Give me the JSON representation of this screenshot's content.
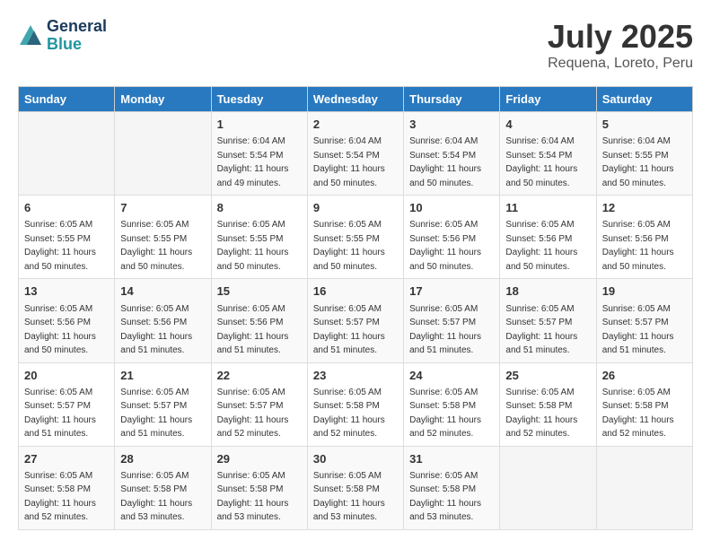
{
  "header": {
    "logo_line1": "General",
    "logo_line2": "Blue",
    "month_title": "July 2025",
    "location": "Requena, Loreto, Peru"
  },
  "days_of_week": [
    "Sunday",
    "Monday",
    "Tuesday",
    "Wednesday",
    "Thursday",
    "Friday",
    "Saturday"
  ],
  "weeks": [
    [
      {
        "day": "",
        "info": ""
      },
      {
        "day": "",
        "info": ""
      },
      {
        "day": "1",
        "info": "Sunrise: 6:04 AM\nSunset: 5:54 PM\nDaylight: 11 hours and 49 minutes."
      },
      {
        "day": "2",
        "info": "Sunrise: 6:04 AM\nSunset: 5:54 PM\nDaylight: 11 hours and 50 minutes."
      },
      {
        "day": "3",
        "info": "Sunrise: 6:04 AM\nSunset: 5:54 PM\nDaylight: 11 hours and 50 minutes."
      },
      {
        "day": "4",
        "info": "Sunrise: 6:04 AM\nSunset: 5:54 PM\nDaylight: 11 hours and 50 minutes."
      },
      {
        "day": "5",
        "info": "Sunrise: 6:04 AM\nSunset: 5:55 PM\nDaylight: 11 hours and 50 minutes."
      }
    ],
    [
      {
        "day": "6",
        "info": "Sunrise: 6:05 AM\nSunset: 5:55 PM\nDaylight: 11 hours and 50 minutes."
      },
      {
        "day": "7",
        "info": "Sunrise: 6:05 AM\nSunset: 5:55 PM\nDaylight: 11 hours and 50 minutes."
      },
      {
        "day": "8",
        "info": "Sunrise: 6:05 AM\nSunset: 5:55 PM\nDaylight: 11 hours and 50 minutes."
      },
      {
        "day": "9",
        "info": "Sunrise: 6:05 AM\nSunset: 5:55 PM\nDaylight: 11 hours and 50 minutes."
      },
      {
        "day": "10",
        "info": "Sunrise: 6:05 AM\nSunset: 5:56 PM\nDaylight: 11 hours and 50 minutes."
      },
      {
        "day": "11",
        "info": "Sunrise: 6:05 AM\nSunset: 5:56 PM\nDaylight: 11 hours and 50 minutes."
      },
      {
        "day": "12",
        "info": "Sunrise: 6:05 AM\nSunset: 5:56 PM\nDaylight: 11 hours and 50 minutes."
      }
    ],
    [
      {
        "day": "13",
        "info": "Sunrise: 6:05 AM\nSunset: 5:56 PM\nDaylight: 11 hours and 50 minutes."
      },
      {
        "day": "14",
        "info": "Sunrise: 6:05 AM\nSunset: 5:56 PM\nDaylight: 11 hours and 51 minutes."
      },
      {
        "day": "15",
        "info": "Sunrise: 6:05 AM\nSunset: 5:56 PM\nDaylight: 11 hours and 51 minutes."
      },
      {
        "day": "16",
        "info": "Sunrise: 6:05 AM\nSunset: 5:57 PM\nDaylight: 11 hours and 51 minutes."
      },
      {
        "day": "17",
        "info": "Sunrise: 6:05 AM\nSunset: 5:57 PM\nDaylight: 11 hours and 51 minutes."
      },
      {
        "day": "18",
        "info": "Sunrise: 6:05 AM\nSunset: 5:57 PM\nDaylight: 11 hours and 51 minutes."
      },
      {
        "day": "19",
        "info": "Sunrise: 6:05 AM\nSunset: 5:57 PM\nDaylight: 11 hours and 51 minutes."
      }
    ],
    [
      {
        "day": "20",
        "info": "Sunrise: 6:05 AM\nSunset: 5:57 PM\nDaylight: 11 hours and 51 minutes."
      },
      {
        "day": "21",
        "info": "Sunrise: 6:05 AM\nSunset: 5:57 PM\nDaylight: 11 hours and 51 minutes."
      },
      {
        "day": "22",
        "info": "Sunrise: 6:05 AM\nSunset: 5:57 PM\nDaylight: 11 hours and 52 minutes."
      },
      {
        "day": "23",
        "info": "Sunrise: 6:05 AM\nSunset: 5:58 PM\nDaylight: 11 hours and 52 minutes."
      },
      {
        "day": "24",
        "info": "Sunrise: 6:05 AM\nSunset: 5:58 PM\nDaylight: 11 hours and 52 minutes."
      },
      {
        "day": "25",
        "info": "Sunrise: 6:05 AM\nSunset: 5:58 PM\nDaylight: 11 hours and 52 minutes."
      },
      {
        "day": "26",
        "info": "Sunrise: 6:05 AM\nSunset: 5:58 PM\nDaylight: 11 hours and 52 minutes."
      }
    ],
    [
      {
        "day": "27",
        "info": "Sunrise: 6:05 AM\nSunset: 5:58 PM\nDaylight: 11 hours and 52 minutes."
      },
      {
        "day": "28",
        "info": "Sunrise: 6:05 AM\nSunset: 5:58 PM\nDaylight: 11 hours and 53 minutes."
      },
      {
        "day": "29",
        "info": "Sunrise: 6:05 AM\nSunset: 5:58 PM\nDaylight: 11 hours and 53 minutes."
      },
      {
        "day": "30",
        "info": "Sunrise: 6:05 AM\nSunset: 5:58 PM\nDaylight: 11 hours and 53 minutes."
      },
      {
        "day": "31",
        "info": "Sunrise: 6:05 AM\nSunset: 5:58 PM\nDaylight: 11 hours and 53 minutes."
      },
      {
        "day": "",
        "info": ""
      },
      {
        "day": "",
        "info": ""
      }
    ]
  ]
}
